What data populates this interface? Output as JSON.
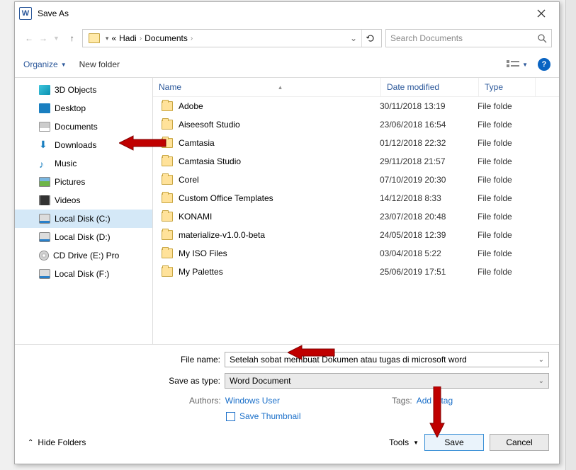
{
  "title": "Save As",
  "path": {
    "prefix": "«",
    "p1": "Hadi",
    "p2": "Documents"
  },
  "search_placeholder": "Search Documents",
  "toolbar": {
    "organize": "Organize",
    "newfolder": "New folder"
  },
  "columns": {
    "name": "Name",
    "date": "Date modified",
    "type": "Type"
  },
  "sidebar": [
    {
      "label": "3D Objects",
      "icon": "ico-3d"
    },
    {
      "label": "Desktop",
      "icon": "ico-desktop"
    },
    {
      "label": "Documents",
      "icon": "ico-doc"
    },
    {
      "label": "Downloads",
      "icon": "ico-down"
    },
    {
      "label": "Music",
      "icon": "ico-music"
    },
    {
      "label": "Pictures",
      "icon": "ico-pic"
    },
    {
      "label": "Videos",
      "icon": "ico-vid"
    },
    {
      "label": "Local Disk (C:)",
      "icon": "ico-disk",
      "selected": true
    },
    {
      "label": "Local Disk (D:)",
      "icon": "ico-disk"
    },
    {
      "label": "CD Drive (E:) Pro",
      "icon": "ico-cd"
    },
    {
      "label": "Local Disk (F:)",
      "icon": "ico-disk"
    }
  ],
  "rows": [
    {
      "name": "Adobe",
      "date": "30/11/2018 13:19",
      "type": "File folde"
    },
    {
      "name": "Aiseesoft Studio",
      "date": "23/06/2018 16:54",
      "type": "File folde"
    },
    {
      "name": "Camtasia",
      "date": "01/12/2018 22:32",
      "type": "File folde"
    },
    {
      "name": "Camtasia Studio",
      "date": "29/11/2018 21:57",
      "type": "File folde"
    },
    {
      "name": "Corel",
      "date": "07/10/2019 20:30",
      "type": "File folde"
    },
    {
      "name": "Custom Office Templates",
      "date": "14/12/2018 8:33",
      "type": "File folde"
    },
    {
      "name": "KONAMI",
      "date": "23/07/2018 20:48",
      "type": "File folde"
    },
    {
      "name": "materialize-v1.0.0-beta",
      "date": "24/05/2018 12:39",
      "type": "File folde"
    },
    {
      "name": "My ISO Files",
      "date": "03/04/2018 5:22",
      "type": "File folde"
    },
    {
      "name": "My Palettes",
      "date": "25/06/2019 17:51",
      "type": "File folde"
    }
  ],
  "filename_label": "File name:",
  "filename_value": "Setelah sobat membuat Dokumen atau tugas di microsoft word",
  "savetype_label": "Save as type:",
  "savetype_value": "Word Document",
  "authors_label": "Authors:",
  "authors_value": "Windows User",
  "tags_label": "Tags:",
  "tags_value": "Add a tag",
  "save_thumb": "Save Thumbnail",
  "hide_folders": "Hide Folders",
  "tools": "Tools",
  "save": "Save",
  "cancel": "Cancel"
}
